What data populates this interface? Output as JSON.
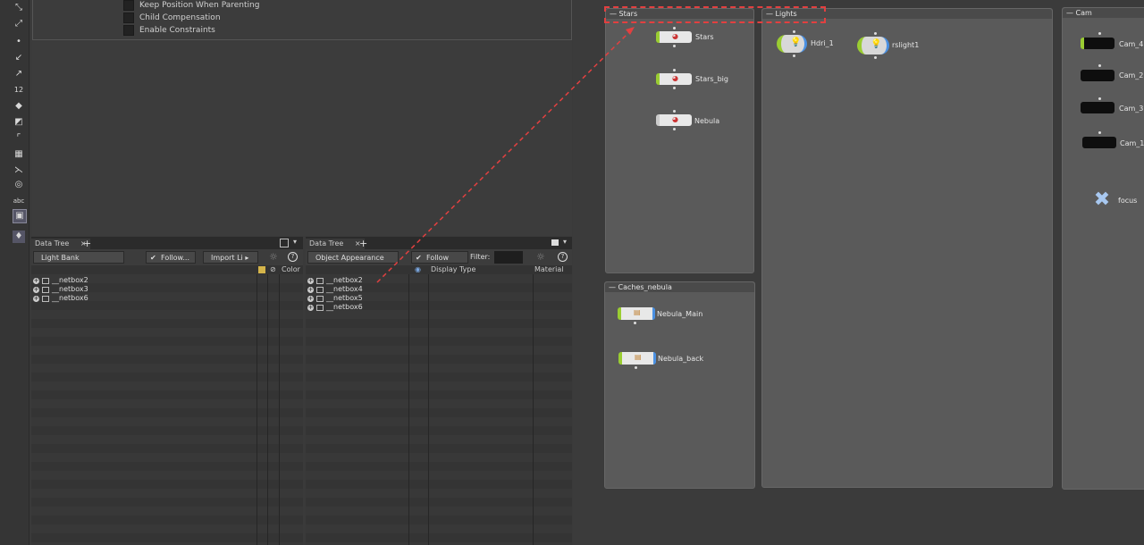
{
  "parameters": {
    "checkboxes": [
      "Keep Position When Parenting",
      "Child Compensation",
      "Enable Constraints"
    ]
  },
  "toolbar": {
    "abc_label": "abc",
    "number_label": "12"
  },
  "left_pane": {
    "tab_label": "Data Tree",
    "dropdown_value": "Light Bank",
    "follow_label": "Follow...",
    "import_label": "Import Li",
    "columns": [
      "Color"
    ],
    "rows": [
      "__netbox2",
      "__netbox3",
      "__netbox6"
    ]
  },
  "right_pane": {
    "tab_label": "Data Tree",
    "dropdown_value": "Object Appearance",
    "follow_label": "Follow Sel...",
    "filter_label": "Filter:",
    "columns": [
      "Display Type",
      "Material"
    ],
    "rows": [
      "__netbox2",
      "__netbox4",
      "__netbox5",
      "__netbox6"
    ]
  },
  "network": {
    "boxes": [
      {
        "title": "Stars"
      },
      {
        "title": "Lights"
      },
      {
        "title": "Cam"
      },
      {
        "title": "Caches_nebula"
      }
    ],
    "nodes": {
      "stars": "Stars",
      "stars_big": "Stars_big",
      "nebula": "Nebula",
      "hdri": "Hdri_1",
      "rslight": "rslight1",
      "cam4": "Cam_4",
      "cam2": "Cam_2",
      "cam3": "Cam_3",
      "cam1": "Cam_1",
      "focus": "focus",
      "nebula_main": "Nebula_Main",
      "nebula_back": "Nebula_back"
    }
  },
  "colors": {
    "highlight": "#e24040",
    "accent_green": "#9acd32",
    "accent_blue": "#4a90e2"
  }
}
